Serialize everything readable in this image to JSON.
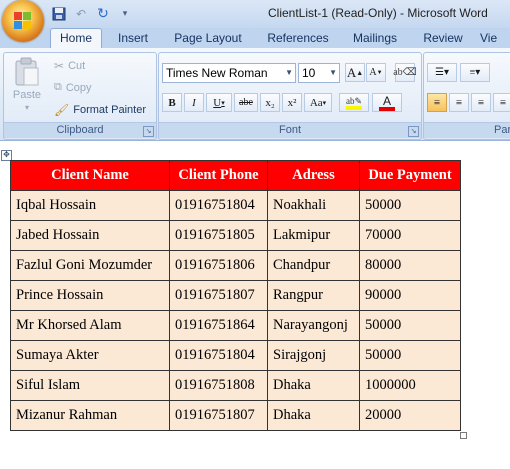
{
  "window": {
    "title": "ClientList-1 (Read-Only) - Microsoft Word"
  },
  "tabs": [
    {
      "label": "Home",
      "active": true
    },
    {
      "label": "Insert"
    },
    {
      "label": "Page Layout"
    },
    {
      "label": "References"
    },
    {
      "label": "Mailings"
    },
    {
      "label": "Review"
    },
    {
      "label": "Vie"
    }
  ],
  "clipboard": {
    "paste_label": "Paste",
    "cut_label": "Cut",
    "copy_label": "Copy",
    "format_painter_label": "Format Painter",
    "group_label": "Clipboard"
  },
  "font": {
    "font_name": "Times New Roman",
    "font_size": "10",
    "group_label": "Font",
    "bold": "B",
    "italic": "I",
    "underline": "U",
    "strikethrough": "abe",
    "subscript": "x₂",
    "superscript": "x²",
    "change_case": "Aa",
    "grow_font": "A",
    "shrink_font": "A"
  },
  "paragraph": {
    "group_label": "Para"
  },
  "accent_colors": {
    "table_header": "#fe0000",
    "table_cell": "#fbe8d5",
    "font_color_bar": "#e00000",
    "highlight_bar": "#f7f700"
  },
  "table": {
    "headers": [
      "Client Name",
      "Client Phone",
      "Adress",
      "Due Payment"
    ],
    "rows": [
      [
        "Iqbal Hossain",
        "01916751804",
        "Noakhali",
        "50000"
      ],
      [
        "Jabed Hossain",
        "01916751805",
        "Lakmipur",
        "70000"
      ],
      [
        "Fazlul Goni Mozumder",
        "01916751806",
        "Chandpur",
        "80000"
      ],
      [
        "Prince Hossain",
        "01916751807",
        "Rangpur",
        "90000"
      ],
      [
        "Mr Khorsed Alam",
        "01916751864",
        "Narayangonj",
        "50000"
      ],
      [
        "Sumaya Akter",
        "01916751804",
        "Sirajgonj",
        "50000"
      ],
      [
        "Siful Islam",
        "01916751808",
        "Dhaka",
        "1000000"
      ],
      [
        "Mizanur Rahman",
        "01916751807",
        "Dhaka",
        "20000"
      ]
    ]
  }
}
